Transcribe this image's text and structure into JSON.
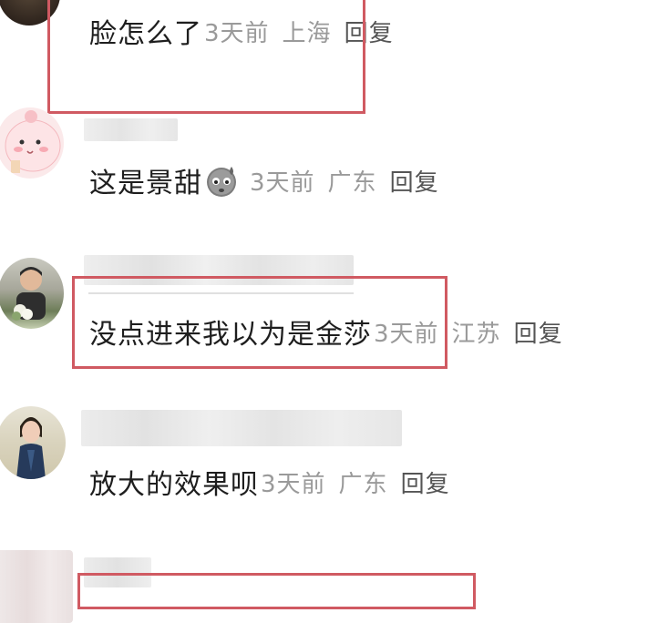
{
  "colors": {
    "highlight": "#d05a62",
    "text": "#1e1e1e",
    "meta": "#9a9a9a",
    "reply": "#555555"
  },
  "comments": [
    {
      "text": "脸怎么了",
      "time": "3天前",
      "location": "上海",
      "reply": "回复"
    },
    {
      "text": "这是景甜",
      "emoji": "sweat-face-icon",
      "time": "3天前",
      "location": "广东",
      "reply": "回复"
    },
    {
      "text": "没点进来我以为是金莎",
      "time": "3天前",
      "location": "江苏",
      "reply": "回复"
    },
    {
      "text": "放大的效果呗",
      "time": "3天前",
      "location": "广东",
      "reply": "回复"
    }
  ]
}
